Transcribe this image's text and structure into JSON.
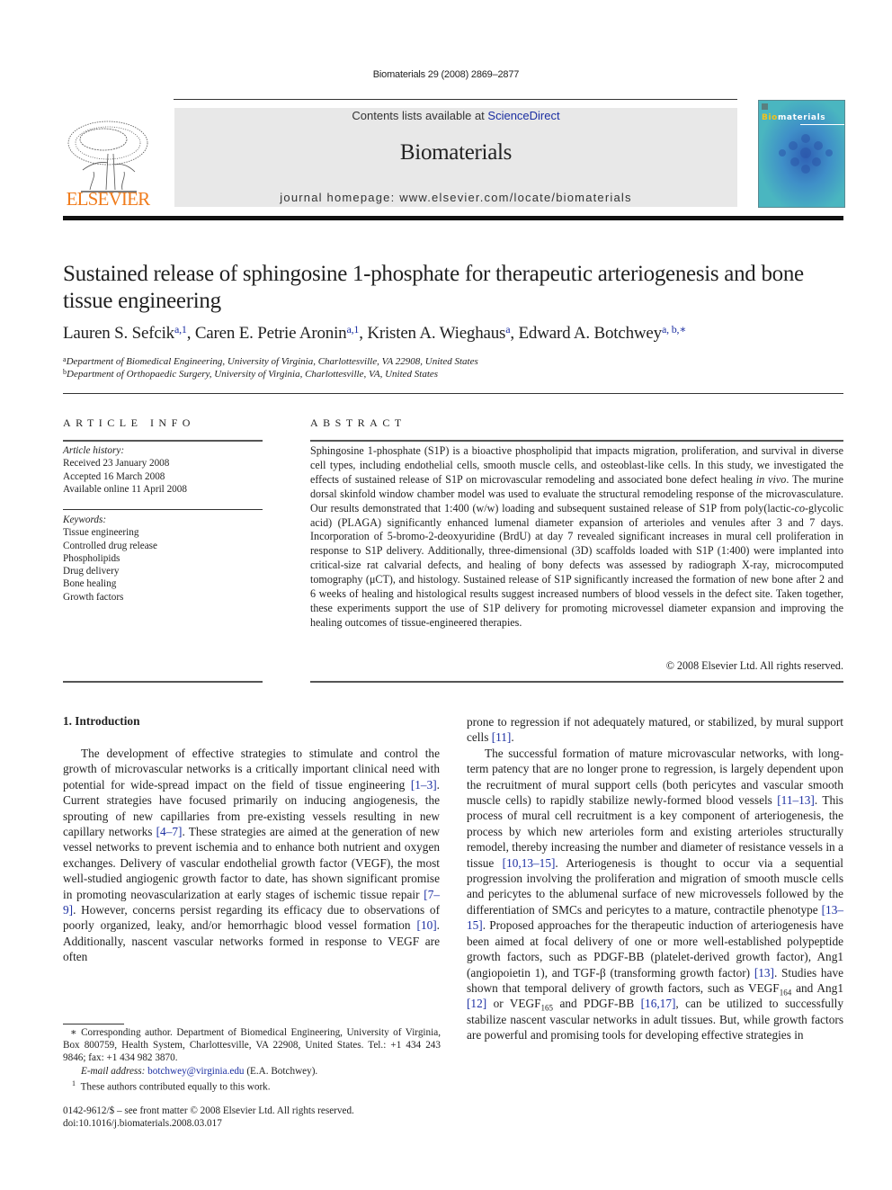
{
  "header": {
    "running_head": "Biomaterials 29 (2008) 2869–2877",
    "contents_prefix": "Contents lists available at ",
    "contents_link": "ScienceDirect",
    "journal_title": "Biomaterials",
    "homepage": "journal homepage: www.elsevier.com/locate/biomaterials",
    "publisher_logo_text": "ELSEVIER",
    "cover": {
      "title_highlight": "Bio",
      "title_rest": "materials"
    },
    "colors": {
      "elsevier_orange": "#f07c1c",
      "link_blue": "#1c2fa2",
      "cover_teal": "#4ab6c0",
      "banner_gray": "#e8e8e8"
    }
  },
  "article": {
    "title": "Sustained release of sphingosine 1-phosphate for therapeutic arteriogenesis and bone tissue engineering",
    "authors": [
      {
        "name": "Lauren S. Sefcik",
        "sup": "a,1"
      },
      {
        "name": "Caren E. Petrie Aronin",
        "sup": "a,1"
      },
      {
        "name": "Kristen A. Wieghaus",
        "sup": "a"
      },
      {
        "name": "Edward A. Botchwey",
        "sup": "a, b,∗"
      }
    ],
    "affiliations": [
      {
        "mark": "a",
        "text": "Department of Biomedical Engineering, University of Virginia, Charlottesville, VA 22908, United States"
      },
      {
        "mark": "b",
        "text": "Department of Orthopaedic Surgery, University of Virginia, Charlottesville, VA, United States"
      }
    ]
  },
  "article_info": {
    "heading": "ARTICLE INFO",
    "history_label": "Article history:",
    "history": [
      "Received 23 January 2008",
      "Accepted 16 March 2008",
      "Available online 11 April 2008"
    ],
    "keywords_label": "Keywords:",
    "keywords": [
      "Tissue engineering",
      "Controlled drug release",
      "Phospholipids",
      "Drug delivery",
      "Bone healing",
      "Growth factors"
    ]
  },
  "abstract": {
    "heading": "ABSTRACT",
    "part1": "Sphingosine 1-phosphate (S1P) is a bioactive phospholipid that impacts migration, proliferation, and survival in diverse cell types, including endothelial cells, smooth muscle cells, and osteoblast-like cells. In this study, we investigated the effects of sustained release of S1P on microvascular remodeling and associated bone defect healing ",
    "italic1": "in vivo",
    "part2": ". The murine dorsal skinfold window chamber model was used to evaluate the structural remodeling response of the microvasculature. Our results demonstrated that 1:400 (w/w) loading and subsequent sustained release of S1P from poly(lactic-",
    "italic2": "co",
    "part3": "-glycolic acid) (PLAGA) significantly enhanced lumenal diameter expansion of arterioles and venules after 3 and 7 days. Incorporation of 5-bromo-2-deoxyuridine (BrdU) at day 7 revealed significant increases in mural cell proliferation in response to S1P delivery. Additionally, three-dimensional (3D) scaffolds loaded with S1P (1:400) were implanted into critical-size rat calvarial defects, and healing of bony defects was assessed by radiograph X-ray, microcomputed tomography (μCT), and histology. Sustained release of S1P significantly increased the formation of new bone after 2 and 6 weeks of healing and histological results suggest increased numbers of blood vessels in the defect site. Taken together, these experiments support the use of S1P delivery for promoting microvessel diameter expansion and improving the healing outcomes of tissue-engineered therapies.",
    "copyright": "© 2008 Elsevier Ltd. All rights reserved."
  },
  "introduction": {
    "heading": "1.  Introduction",
    "left_col": {
      "p1_a": "The development of effective strategies to stimulate and control the growth of microvascular networks is a critically important clinical need with potential for wide-spread impact on the field of tissue engineering ",
      "r1": "[1–3]",
      "p1_b": ". Current strategies have focused primarily on inducing angiogenesis, the sprouting of new capillaries from pre-existing vessels resulting in new capillary networks ",
      "r2": "[4–7]",
      "p1_c": ". These strategies are aimed at the generation of new vessel networks to prevent ischemia and to enhance both nutrient and oxygen exchanges. Delivery of vascular endothelial growth factor (VEGF), the most well-studied angiogenic growth factor to date, has shown significant promise in promoting neovascularization at early stages of ischemic tissue repair ",
      "r3": "[7–9]",
      "p1_d": ". However, concerns persist regarding its efficacy due to observations of poorly organized, leaky, and/or hemorrhagic blood vessel formation ",
      "r4": "[10]",
      "p1_e": ". Additionally, nascent vascular networks formed in response to VEGF are often"
    },
    "right_col": {
      "p1_a": "prone to regression if not adequately matured, or stabilized, by mural support cells ",
      "r1": "[11]",
      "p1_b": ".",
      "p2_a": "The successful formation of mature microvascular networks, with long-term patency that are no longer prone to regression, is largely dependent upon the recruitment of mural support cells (both pericytes and vascular smooth muscle cells) to rapidly stabilize newly-formed blood vessels ",
      "r2": "[11–13]",
      "p2_b": ". This process of mural cell recruitment is a key component of arteriogenesis, the process by which new arterioles form and existing arterioles structurally remodel, thereby increasing the number and diameter of resistance vessels in a tissue ",
      "r3": "[10,13–15]",
      "p2_c": ". Arteriogenesis is thought to occur via a sequential progression involving the proliferation and migration of smooth muscle cells and pericytes to the ablumenal surface of new microvessels followed by the differentiation of SMCs and pericytes to a mature, contractile phenotype ",
      "r4": "[13–15]",
      "p2_d": ". Proposed approaches for the therapeutic induction of arteriogenesis have been aimed at focal delivery of one or more well-established polypeptide growth factors, such as PDGF-BB (platelet-derived growth factor), Ang1 (angiopoietin 1), and TGF-β (transforming growth factor) ",
      "r5": "[13]",
      "p2_e": ". Studies have shown that temporal delivery of growth factors, such as VEGF",
      "sub1": "164",
      "p2_f": " and Ang1 ",
      "r6": "[12]",
      "p2_g": " or VEGF",
      "sub2": "165",
      "p2_h": " and PDGF-BB ",
      "r7": "[16,17]",
      "p2_i": ", can be utilized to successfully stabilize nascent vascular networks in adult tissues. But, while growth factors are powerful and promising tools for developing effective strategies in"
    }
  },
  "footnotes": {
    "corresponding": "∗  Corresponding author. Department of Biomedical Engineering, University of Virginia, Box 800759, Health System, Charlottesville, VA 22908, United States. Tel.: +1 434 243 9846; fax: +1 434 982 3870.",
    "email_label": "E-mail address:",
    "email": "botchwey@virginia.edu",
    "email_suffix": " (E.A. Botchwey).",
    "equal_mark": "1",
    "equal": "These authors contributed equally to this work."
  },
  "front_matter": {
    "issn": "0142-9612/$ – see front matter © 2008 Elsevier Ltd. All rights reserved.",
    "doi": "doi:10.1016/j.biomaterials.2008.03.017"
  }
}
